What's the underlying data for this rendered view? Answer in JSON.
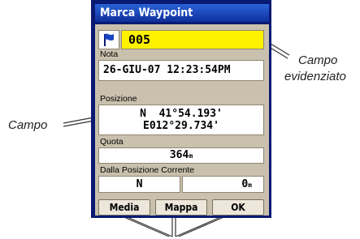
{
  "window": {
    "title": "Marca Waypoint"
  },
  "waypoint": {
    "name": "005",
    "flag_icon": "flag-icon"
  },
  "note": {
    "label": "Nota",
    "value": "26-GIU-07 12:23:54PM"
  },
  "position": {
    "label": "Posizione",
    "lat": "N  41°54.193'",
    "lon": "E012°29.734'"
  },
  "altitude": {
    "label": "Quota",
    "value": "364",
    "unit": "m"
  },
  "from_current": {
    "label": "Dalla Posizione Corrente",
    "bearing": "N",
    "distance": "0",
    "unit": "m"
  },
  "buttons": {
    "average": "Media",
    "map": "Mappa",
    "ok": "OK"
  },
  "annotations": {
    "field": "Campo",
    "highlighted_line1": "Campo",
    "highlighted_line2": "evidenziato"
  },
  "colors": {
    "title_bar": "#1a45c0",
    "panel": "#c9c1ad",
    "highlight": "#fff200"
  }
}
